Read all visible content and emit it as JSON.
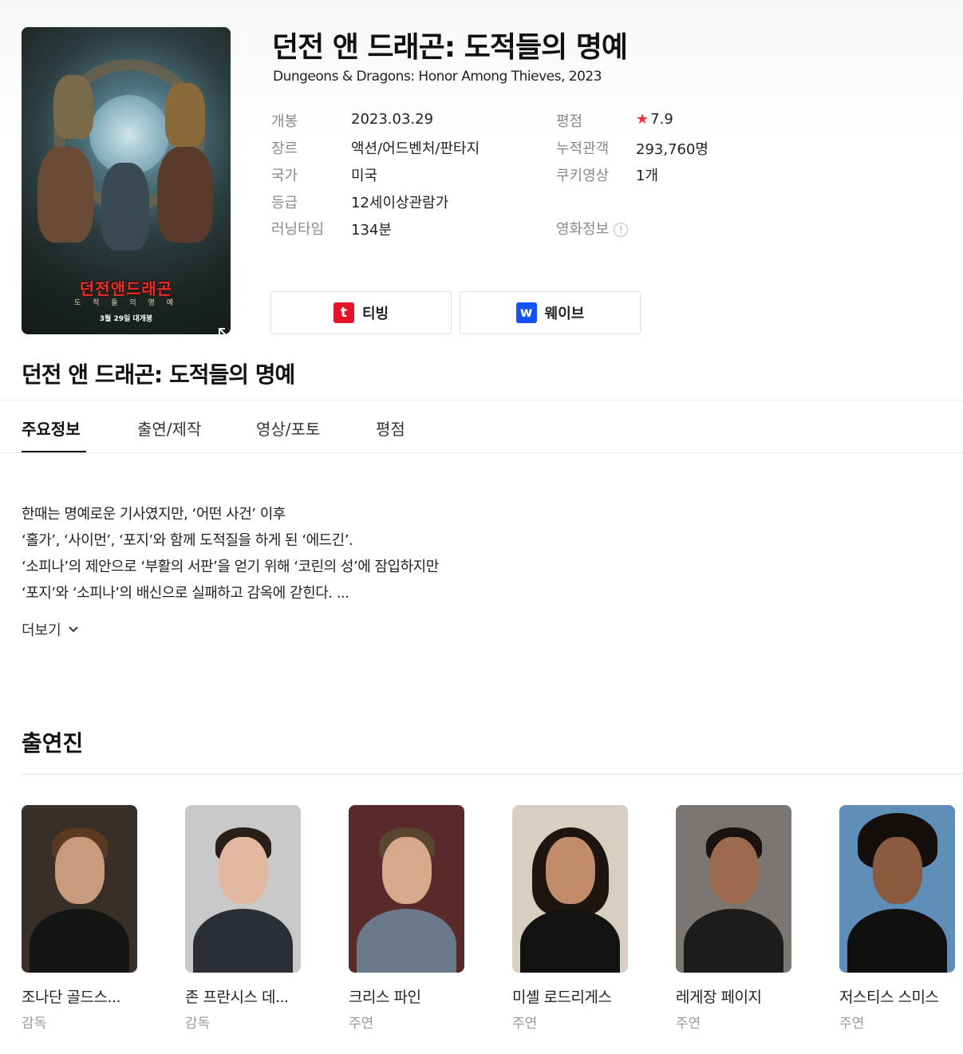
{
  "movie": {
    "title_ko": "던전 앤 드래곤: 도적들의 명예",
    "title_en": "Dungeons & Dragons: Honor Among Thieves, 2023",
    "poster": {
      "title": "던전앤드래곤",
      "subtitle": "도 적 들 의 명 예",
      "date": "3월 29일 대개봉"
    }
  },
  "info_left": [
    {
      "label": "개봉",
      "value": "2023.03.29"
    },
    {
      "label": "장르",
      "value": "액션/어드벤처/판타지"
    },
    {
      "label": "국가",
      "value": "미국"
    },
    {
      "label": "등급",
      "value": "12세이상관람가"
    },
    {
      "label": "러닝타임",
      "value": "134분"
    }
  ],
  "info_right": [
    {
      "label": "평점",
      "value": "7.9",
      "icon": "star-icon"
    },
    {
      "label": "누적관객",
      "value": "293,760명"
    },
    {
      "label": "쿠키영상",
      "value": "1개"
    },
    {
      "label": "영화정보",
      "value": "",
      "icon": "info-icon"
    }
  ],
  "ott": [
    {
      "label": "티빙",
      "logo": "t",
      "color": "#e4132c"
    },
    {
      "label": "웨이브",
      "logo": "w",
      "color": "#1351f9"
    }
  ],
  "tabs": [
    "주요정보",
    "출연/제작",
    "영상/포토",
    "평점"
  ],
  "synopsis": [
    "한때는 명예로운 기사였지만, ‘어떤 사건’ 이후",
    "‘홀가’, ‘사이먼’, ‘포지’와 함께 도적질을 하게 된 ‘에드긴’.",
    "‘소피나’의 제안으로 ‘부활의 서판’을 얻기 위해 ‘코린의 성’에 잠입하지만",
    "‘포지’와 ‘소피나’의 배신으로 실패하고 감옥에 갇힌다. ..."
  ],
  "more_label": "더보기",
  "cast_title": "출연진",
  "cast": [
    {
      "name": "조나단 골드스...",
      "role": "감독"
    },
    {
      "name": "존 프란시스 데...",
      "role": "감독"
    },
    {
      "name": "크리스 파인",
      "role": "주연"
    },
    {
      "name": "미셸 로드리게스",
      "role": "주연"
    },
    {
      "name": "레게장 페이지",
      "role": "주연"
    },
    {
      "name": "저스티스 스미스",
      "role": "주연"
    }
  ]
}
